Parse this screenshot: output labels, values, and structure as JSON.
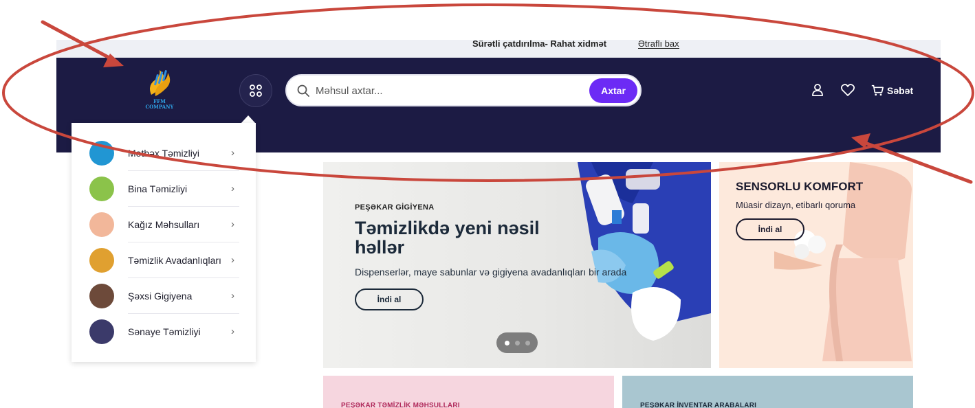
{
  "topbar": {
    "text": "Sürətli çatdırılma- Rahat xidmət",
    "link": "Ətraflı bax"
  },
  "logo": {
    "text": "FFM COMPANY"
  },
  "search": {
    "placeholder": "Məhsul axtar...",
    "button": "Axtar"
  },
  "header_actions": {
    "cart_label": "Səbət"
  },
  "menu": {
    "items": [
      {
        "label": "Mətbəx Təmizliyi",
        "color": "#2196d3"
      },
      {
        "label": "Bina Təmizliyi",
        "color": "#8bc34a"
      },
      {
        "label": "Kağız Məhsulları",
        "color": "#f2b79a"
      },
      {
        "label": "Təmizlik Avadanlıqları",
        "color": "#e0a030"
      },
      {
        "label": "Şəxsi Gigiyena",
        "color": "#6d4a3a"
      },
      {
        "label": "Sənaye Təmizliyi",
        "color": "#3b3a6a"
      }
    ]
  },
  "hero": {
    "eyebrow": "PEŞƏKAR GİGİYENA",
    "title": "Təmizlikdə yeni nəsil həllər",
    "description": "Dispenserlər, maye sabunlar və gigiyena avadanlıqları bir arada",
    "button": "İndi al",
    "slides": 3,
    "active_slide": 1
  },
  "side_banner": {
    "title": "SENSORLU KOMFORT",
    "description": "Müasir dizayn, etibarlı qoruma",
    "button": "İndi al"
  },
  "promos": [
    {
      "label": "PEŞƏKAR TƏMİZLİK MƏHSULLARI",
      "color": "#b12a5b"
    },
    {
      "label": "PEŞƏKAR İNVENTAR ARABALARI",
      "color": "#1c2a3a"
    }
  ],
  "colors": {
    "header_bg": "#1c1b44",
    "accent": "#6c2bf5",
    "annotation": "#c9473c"
  }
}
